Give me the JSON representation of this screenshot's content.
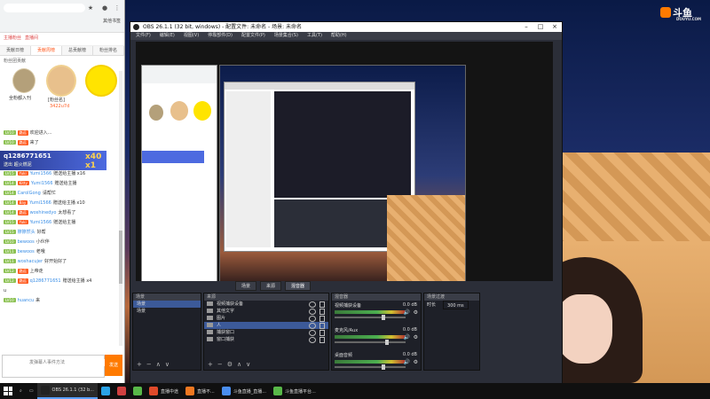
{
  "desktop": {
    "logo": "斗鱼",
    "logo_sub": "DOUYU.COM"
  },
  "chat": {
    "bookmark": "其他书签",
    "top_tabs": [
      "主播粉丝",
      "直播间"
    ],
    "sub_tabs": [
      "贡献日榜",
      "贡献周榜",
      "总贡献榜",
      "粉丝排名"
    ],
    "fans_title": "粉丝团贡献",
    "fans": [
      {
        "name": "全粉都入刊",
        "num": ""
      },
      {
        "name": "[粉丝名]",
        "num": "3422u7d"
      },
      {
        "name": "",
        "num": ""
      }
    ],
    "gift_banner": {
      "name": "q1286771651",
      "sub": "送出 超火燃泥",
      "count": "x40 x1"
    },
    "messages": [
      {
        "lv": "LV10",
        "badge": "路远",
        "nick": "",
        "text": "欢迎进入..."
      },
      {
        "lv": "LV10",
        "badge": "路远",
        "nick": "",
        "text": "来了"
      },
      {
        "lv": "LV15",
        "badge": "Yuki",
        "nick": "Yumi1566",
        "text": "赠送给主播 x16"
      },
      {
        "lv": "LV14",
        "badge": "Kitty",
        "nick": "Yumi1566",
        "text": "赠送给主播"
      },
      {
        "lv": "LV14",
        "badge": "",
        "nick": "CarolGong",
        "text": "请帮忙"
      },
      {
        "lv": "LV14",
        "badge": "Bay",
        "nick": "Yumi1566",
        "text": "赠送给主播 x10"
      },
      {
        "lv": "LV14",
        "badge": "路远",
        "nick": "woshinedyo",
        "text": "太想看了"
      },
      {
        "lv": "LV15",
        "badge": "Yuki",
        "nick": "Yumi1566",
        "text": "赠送给主播"
      },
      {
        "lv": "LV15",
        "badge": "",
        "nick": "擦擦然头",
        "text": "好帮"
      },
      {
        "lv": "LV10",
        "badge": "",
        "nick": "bewoos",
        "text": "小伙伴"
      },
      {
        "lv": "LV11",
        "badge": "",
        "nick": "bewoos",
        "text": "老哦"
      },
      {
        "lv": "LV11",
        "badge": "",
        "nick": "woshacujer",
        "text": "好开始好了"
      },
      {
        "lv": "LV12",
        "badge": "路远",
        "nick": "",
        "text": "上帝走"
      },
      {
        "lv": "LV12",
        "badge": "路远",
        "nick": "q1286771651",
        "text": "赠送给主播 x4"
      },
      {
        "lv": "",
        "badge": "",
        "nick": "",
        "text": "u"
      },
      {
        "lv": "LV10",
        "badge": "",
        "nick": "huancu",
        "text": "来"
      }
    ],
    "input_placeholder": "发弹幕人事件方法",
    "send_label": "发送"
  },
  "obs": {
    "title": "OBS 26.1.1 (32 bit, windows) - 配置文件: 未命名 - 场景: 未命名",
    "menu": [
      "文件(F)",
      "编辑(E)",
      "视图(V)",
      "停靠部件(D)",
      "配置文件(P)",
      "场景集合(S)",
      "工具(T)",
      "帮助(H)"
    ],
    "dock_tabs": [
      "场景",
      "来源",
      "混音器"
    ],
    "scenes_header": "场景",
    "scenes": [
      "场景",
      "场景"
    ],
    "sources_header": "来源",
    "sources": [
      "视频捕获设备",
      "其他文字 ",
      "图片",
      "人",
      "捕获窗口",
      "窗口捕获"
    ],
    "mixer_header": "混音器",
    "mixer": [
      {
        "name": "视频捕获设备",
        "db": "0.0 dB",
        "knob": 0.7
      },
      {
        "name": "麦克风/Aux",
        "db": "0.0 dB",
        "knob": 0.75
      },
      {
        "name": "桌面音频",
        "db": "0.0 dB",
        "knob": 0.7
      }
    ],
    "transition_header": "场景过渡",
    "transition_label": "时长",
    "transition_value": "300 ms"
  },
  "taskbar": {
    "items": [
      {
        "label": "OBS 26.1.1 (32 b...",
        "color": "#222222",
        "active": true
      },
      {
        "label": "",
        "color": "#2aa3e6",
        "active": false
      },
      {
        "label": "",
        "color": "#d04040",
        "active": false
      },
      {
        "label": "",
        "color": "#58b848",
        "active": false
      },
      {
        "label": "直播中途",
        "color": "#e04a2a",
        "active": false
      },
      {
        "label": "直播不...",
        "color": "#f07820",
        "active": false
      },
      {
        "label": "斗鱼直播_直播...",
        "color": "#4a8ef0",
        "active": false
      },
      {
        "label": "斗鱼直播平台...",
        "color": "#58b848",
        "active": false
      }
    ]
  }
}
